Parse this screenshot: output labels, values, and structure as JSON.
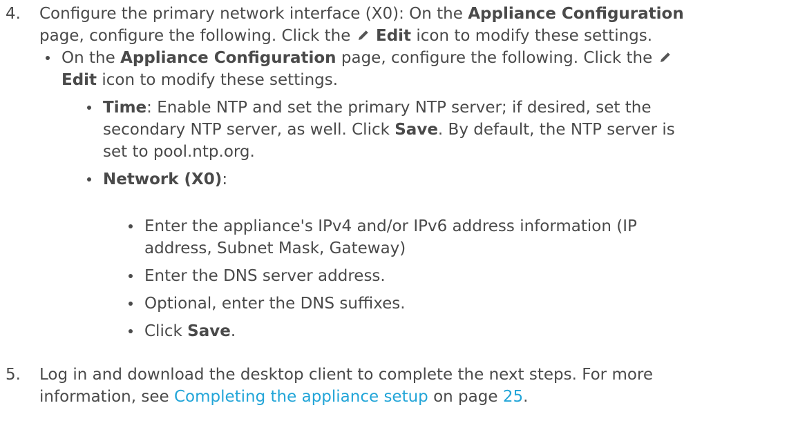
{
  "step4": {
    "number": "4.",
    "line1_pre": "Configure the primary network interface (X0): On the ",
    "line1_bold": "Appliance Configuration",
    "line2_pre": "page, configure the following. Click the ",
    "edit_label": "Edit",
    "line2_post": " icon to modify these settings.",
    "bullet1": {
      "pre": "On the ",
      "bold": "Appliance Configuration",
      "mid": " page, configure the following. Click the",
      "edit_label": "Edit",
      "post": " icon to modify these settings."
    },
    "time": {
      "label": "Time",
      "line1": ": Enable NTP and set the primary NTP server; if desired, set the",
      "line2_pre": "secondary NTP server, as well. Click ",
      "save_label": "Save",
      "line2_post": ". By default, the NTP server is",
      "line3": "set to pool.ntp.org."
    },
    "network": {
      "label": "Network (X0)",
      "suffix": ":",
      "items": [
        "Enter the appliance's IPv4 and/or IPv6 address information (IP",
        "address, Subnet Mask, Gateway)",
        "Enter the DNS server address.",
        "Optional, enter the DNS suffixes.",
        "Click ",
        "Save",
        "."
      ]
    }
  },
  "step5": {
    "number": "5.",
    "line1": "Log in and download the desktop client to complete the next steps. For more",
    "line2_pre": "information, see ",
    "link_text": "Completing the appliance setup",
    "line2_mid": " on page ",
    "page_link": "25",
    "line2_post": "."
  },
  "icons": {
    "edit": "pencil-icon"
  }
}
